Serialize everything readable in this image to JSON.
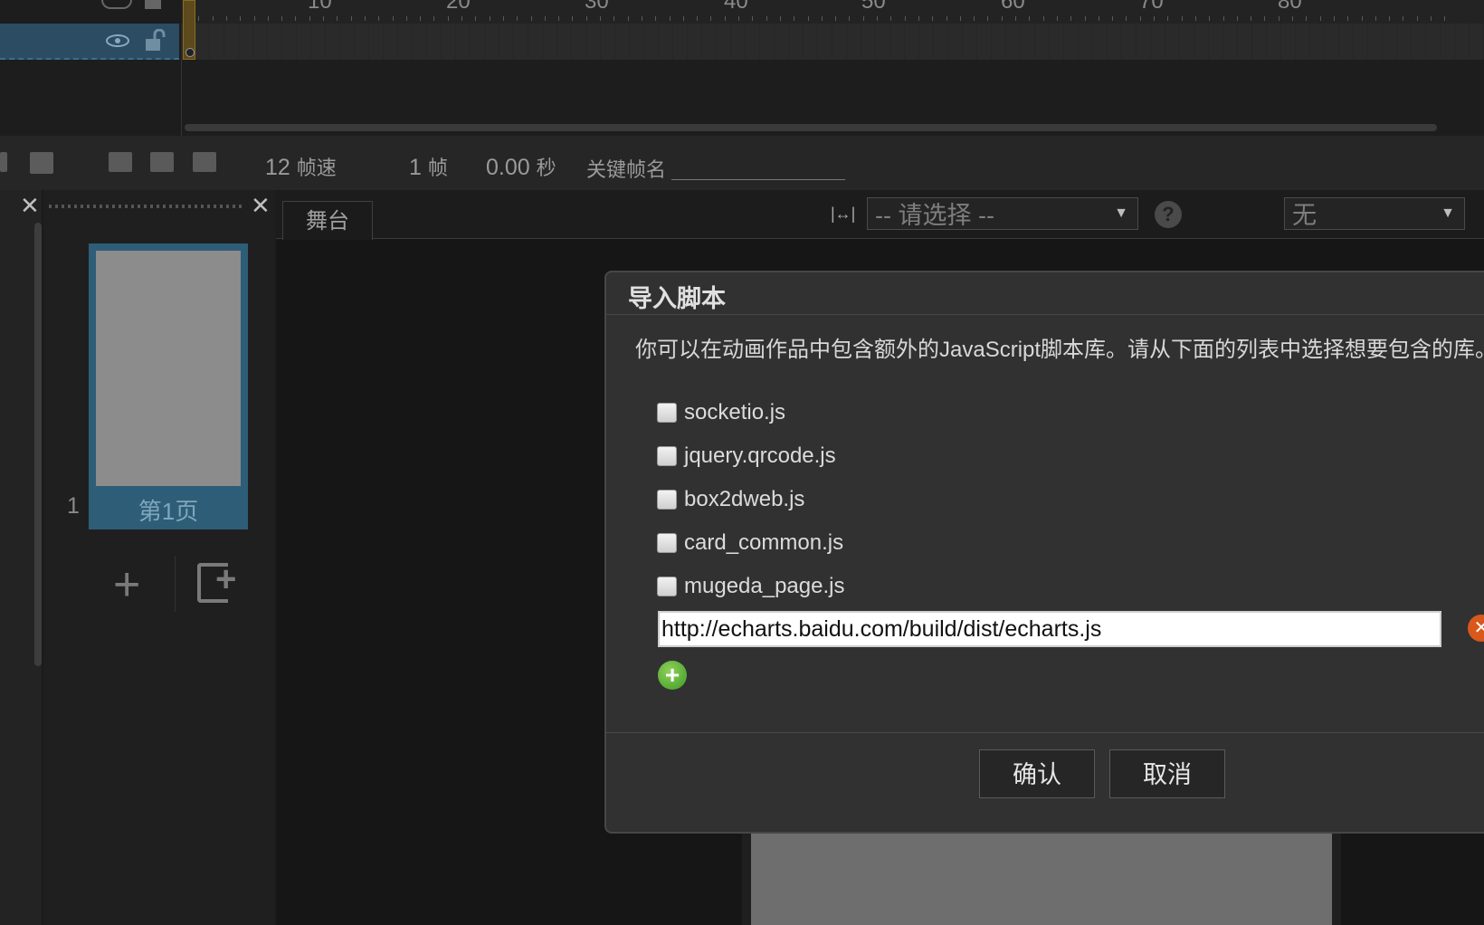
{
  "timeline": {
    "ruler_numbers": [
      "10",
      "20",
      "30",
      "40",
      "50",
      "60",
      "70",
      "80"
    ]
  },
  "toolbar": {
    "fps_value": "12",
    "fps_label": "帧速",
    "frame_value": "1",
    "frame_label": "帧",
    "seconds_value": "0.00",
    "seconds_label": "秒",
    "keyframe_name_label": "关键帧名"
  },
  "pages": {
    "close_glyph": "✕",
    "items": [
      {
        "number": "1",
        "label": "第1页"
      }
    ],
    "add_glyph": "+"
  },
  "stage": {
    "tab_label": "舞台",
    "align_glyph": "|↔|",
    "select_placeholder": "-- 请选择 --",
    "help_glyph": "?",
    "second_select_value": "无",
    "arrow_glyph": "▼"
  },
  "dialog": {
    "title": "导入脚本",
    "description": "你可以在动画作品中包含额外的JavaScript脚本库。请从下面的列表中选择想要包含的库。",
    "libraries": [
      "socketio.js",
      "jquery.qrcode.js",
      "box2dweb.js",
      "card_common.js",
      "mugeda_page.js"
    ],
    "url_value": "http://echarts.baidu.com/build/dist/echarts.js",
    "remove_glyph": "✕",
    "add_glyph": "+",
    "confirm_label": "确认",
    "cancel_label": "取消"
  },
  "colors": {
    "selected_page": "#2e5d78",
    "remove_button": "#d9581b",
    "add_button": "#3d9a26"
  }
}
